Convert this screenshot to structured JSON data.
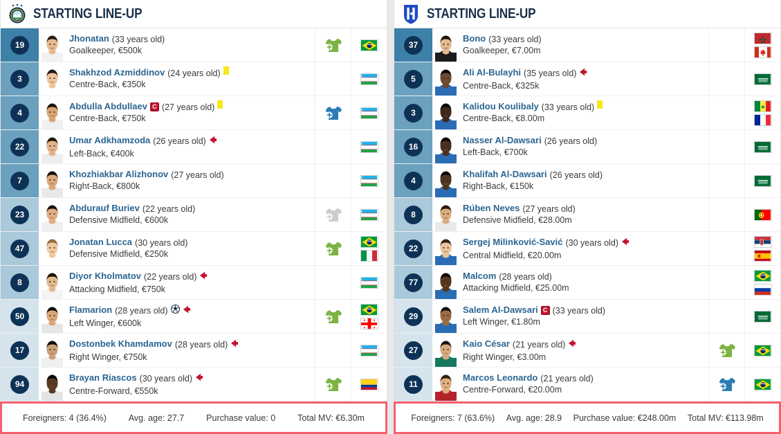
{
  "title": "Starting line-up comparison",
  "colors": {
    "accent_link": "#2b6591",
    "badge_bg": "#0e3255",
    "highlight_border": "#f4606e",
    "gk_tint": "#3d80a8",
    "def_tint": "#6ba0bf",
    "mid_tint": "#aac9da",
    "fwd_tint": "#d4e3ec"
  },
  "home": {
    "header": {
      "title": "STARTING LINE-UP",
      "logo_icon": "pakhtakor-club-logo"
    },
    "players": [
      {
        "number": "19",
        "name": "Jhonatan",
        "age": "(33 years old)",
        "position_value": "Goalkeeper, €500k",
        "tint": "t-gk",
        "captain": false,
        "yellow_card": false,
        "goal": false,
        "subbed_off": false,
        "sub_icon": "substitution-in-icon",
        "sub_icon_color": "#7cb342",
        "flags": [
          "brazil"
        ],
        "skin": "#e8b98f",
        "hair": "#2b1b10",
        "shirt": "#f2f2f2"
      },
      {
        "number": "3",
        "name": "Shakhzod Azmiddinov",
        "age": "(24 years old)",
        "position_value": "Centre-Back, €350k",
        "tint": "t-def",
        "captain": false,
        "yellow_card": true,
        "goal": false,
        "subbed_off": false,
        "sub_icon": "",
        "sub_icon_color": "",
        "flags": [
          "uzbekistan"
        ],
        "skin": "#edc49c",
        "hair": "#261810",
        "shirt": "#ffffff"
      },
      {
        "number": "4",
        "name": "Abdulla Abdullaev",
        "age": "(27 years old)",
        "position_value": "Centre-Back, €750k",
        "tint": "t-def",
        "captain": true,
        "yellow_card": true,
        "goal": false,
        "subbed_off": false,
        "sub_icon": "substitution-in-icon",
        "sub_icon_color": "#2b7cb5",
        "flags": [
          "uzbekistan"
        ],
        "skin": "#d9a475",
        "hair": "#1c120a",
        "shirt": "#f0f0f0"
      },
      {
        "number": "22",
        "name": "Umar Adkhamzoda",
        "age": "(26 years old)",
        "position_value": "Left-Back, €400k",
        "tint": "t-def",
        "captain": false,
        "yellow_card": false,
        "goal": false,
        "subbed_off": true,
        "sub_icon": "",
        "sub_icon_color": "",
        "flags": [
          "uzbekistan"
        ],
        "skin": "#e2b289",
        "hair": "#241609",
        "shirt": "#ededed"
      },
      {
        "number": "7",
        "name": "Khozhiakbar Alizhonov",
        "age": "(27 years old)",
        "position_value": "Right-Back, €800k",
        "tint": "t-def",
        "captain": false,
        "yellow_card": false,
        "goal": false,
        "subbed_off": false,
        "sub_icon": "",
        "sub_icon_color": "",
        "flags": [
          "uzbekistan"
        ],
        "skin": "#dba87c",
        "hair": "#140d07",
        "shirt": "#e8e8e8"
      },
      {
        "number": "23",
        "name": "Abdurauf Buriev",
        "age": "(22 years old)",
        "position_value": "Defensive Midfield, €600k",
        "tint": "t-mid",
        "captain": false,
        "yellow_card": false,
        "goal": false,
        "subbed_off": false,
        "sub_icon": "substitution-in-icon",
        "sub_icon_color": "#c9cdd0",
        "flags": [
          "uzbekistan"
        ],
        "skin": "#dfae83",
        "hair": "#1a110a",
        "shirt": "#efefef"
      },
      {
        "number": "47",
        "name": "Jonatan Lucca",
        "age": "(30 years old)",
        "position_value": "Defensive Midfield, €250k",
        "tint": "t-mid",
        "captain": false,
        "yellow_card": false,
        "goal": false,
        "subbed_off": false,
        "sub_icon": "substitution-in-icon",
        "sub_icon_color": "#7cb342",
        "flags": [
          "brazil",
          "italy"
        ],
        "skin": "#f0c9a2",
        "hair": "#9a6b3a",
        "shirt": "#ffffff"
      },
      {
        "number": "8",
        "name": "Diyor Kholmatov",
        "age": "(22 years old)",
        "position_value": "Attacking Midfield, €750k",
        "tint": "t-mid",
        "captain": false,
        "yellow_card": false,
        "goal": false,
        "subbed_off": true,
        "sub_icon": "",
        "sub_icon_color": "",
        "flags": [
          "uzbekistan"
        ],
        "skin": "#e4b98f",
        "hair": "#1d1209",
        "shirt": "#f4f4f4"
      },
      {
        "number": "50",
        "name": "Flamarion",
        "age": "(28 years old)",
        "position_value": "Left Winger, €600k",
        "tint": "t-fwd",
        "captain": false,
        "yellow_card": false,
        "goal": true,
        "subbed_off": true,
        "sub_icon": "substitution-in-icon",
        "sub_icon_color": "#7cb342",
        "flags": [
          "brazil",
          "georgia"
        ],
        "skin": "#d9a677",
        "hair": "#120b06",
        "shirt": "#e6e6e6"
      },
      {
        "number": "17",
        "name": "Dostonbek Khamdamov",
        "age": "(28 years old)",
        "position_value": "Right Winger, €750k",
        "tint": "t-fwd",
        "captain": false,
        "yellow_card": false,
        "goal": false,
        "subbed_off": true,
        "sub_icon": "",
        "sub_icon_color": "",
        "flags": [
          "uzbekistan"
        ],
        "skin": "#caa077",
        "hair": "#120b05",
        "shirt": "#efefef"
      },
      {
        "number": "94",
        "name": "Brayan Riascos",
        "age": "(30 years old)",
        "position_value": "Centre-Forward, €550k",
        "tint": "t-fwd",
        "captain": false,
        "yellow_card": false,
        "goal": false,
        "subbed_off": true,
        "sub_icon": "substitution-in-icon",
        "sub_icon_color": "#7cb342",
        "flags": [
          "colombia"
        ],
        "skin": "#5b3a23",
        "hair": "#0c0704",
        "shirt": "#e4e4e4"
      }
    ],
    "footer": {
      "foreigners": "Foreigners: 4 (36.4%)",
      "avg_age": "Avg. age: 27.7",
      "purchase_value": "Purchase value: 0",
      "total_mv": "Total MV: €6.30m"
    }
  },
  "away": {
    "header": {
      "title": "STARTING LINE-UP",
      "logo_icon": "al-hilal-club-logo"
    },
    "players": [
      {
        "number": "37",
        "name": "Bono",
        "age": "(33 years old)",
        "position_value": "Goalkeeper, €7.00m",
        "tint": "t-gk",
        "captain": false,
        "yellow_card": false,
        "goal": false,
        "subbed_off": false,
        "sub_icon": "",
        "sub_icon_color": "",
        "flags": [
          "morocco",
          "canada"
        ],
        "skin": "#e4b98f",
        "hair": "#1a110a",
        "shirt": "#1c1c1c"
      },
      {
        "number": "5",
        "name": "Ali Al-Bulayhi",
        "age": "(35 years old)",
        "position_value": "Centre-Back, €325k",
        "tint": "t-def",
        "captain": false,
        "yellow_card": false,
        "goal": false,
        "subbed_off": true,
        "sub_icon": "",
        "sub_icon_color": "",
        "flags": [
          "saudi-arabia"
        ],
        "skin": "#6b4a2f",
        "hair": "#0d0805",
        "shirt": "#2a6db5"
      },
      {
        "number": "3",
        "name": "Kalidou Koulibaly",
        "age": "(33 years old)",
        "position_value": "Centre-Back, €8.00m",
        "tint": "t-def",
        "captain": false,
        "yellow_card": true,
        "goal": false,
        "subbed_off": false,
        "sub_icon": "",
        "sub_icon_color": "",
        "flags": [
          "senegal",
          "france"
        ],
        "skin": "#3d2718",
        "hair": "#080504",
        "shirt": "#2a6db5"
      },
      {
        "number": "16",
        "name": "Nasser Al-Dawsari",
        "age": "(26 years old)",
        "position_value": "Left-Back, €700k",
        "tint": "t-def",
        "captain": false,
        "yellow_card": false,
        "goal": false,
        "subbed_off": false,
        "sub_icon": "",
        "sub_icon_color": "",
        "flags": [
          "saudi-arabia"
        ],
        "skin": "#4a3020",
        "hair": "#0a0604",
        "shirt": "#2a6db5"
      },
      {
        "number": "4",
        "name": "Khalifah Al-Dawsari",
        "age": "(26 years old)",
        "position_value": "Right-Back, €150k",
        "tint": "t-def",
        "captain": false,
        "yellow_card": false,
        "goal": false,
        "subbed_off": false,
        "sub_icon": "",
        "sub_icon_color": "",
        "flags": [
          "saudi-arabia"
        ],
        "skin": "#4d3422",
        "hair": "#0b0705",
        "shirt": "#2a6db5"
      },
      {
        "number": "8",
        "name": "Rúben Neves",
        "age": "(27 years old)",
        "position_value": "Defensive Midfield, €28.00m",
        "tint": "t-mid",
        "captain": false,
        "yellow_card": false,
        "goal": false,
        "subbed_off": false,
        "sub_icon": "",
        "sub_icon_color": "",
        "flags": [
          "portugal"
        ],
        "skin": "#dcab7e",
        "hair": "#2a1a0e",
        "shirt": "#e9e9e9"
      },
      {
        "number": "22",
        "name": "Sergej Milinković-Savić",
        "age": "(30 years old)",
        "position_value": "Central Midfield, €20.00m",
        "tint": "t-mid",
        "captain": false,
        "yellow_card": false,
        "goal": false,
        "subbed_off": true,
        "sub_icon": "",
        "sub_icon_color": "",
        "flags": [
          "serbia",
          "spain"
        ],
        "skin": "#ecc49b",
        "hair": "#3a2414",
        "shirt": "#2a6db5"
      },
      {
        "number": "77",
        "name": "Malcom",
        "age": "(28 years old)",
        "position_value": "Attacking Midfield, €25.00m",
        "tint": "t-mid",
        "captain": false,
        "yellow_card": false,
        "goal": false,
        "subbed_off": false,
        "sub_icon": "",
        "sub_icon_color": "",
        "flags": [
          "brazil",
          "russia"
        ],
        "skin": "#58371f",
        "hair": "#0b0604",
        "shirt": "#2a6db5"
      },
      {
        "number": "29",
        "name": "Salem Al-Dawsari",
        "age": "(33 years old)",
        "position_value": "Left Winger, €1.80m",
        "tint": "t-fwd",
        "captain": true,
        "yellow_card": false,
        "goal": false,
        "subbed_off": false,
        "sub_icon": "",
        "sub_icon_color": "",
        "flags": [
          "saudi-arabia"
        ],
        "skin": "#9c6b45",
        "hair": "#110a06",
        "shirt": "#2a6db5"
      },
      {
        "number": "27",
        "name": "Kaio César",
        "age": "(21 years old)",
        "position_value": "Right Winger, €3.00m",
        "tint": "t-fwd",
        "captain": false,
        "yellow_card": false,
        "goal": false,
        "subbed_off": true,
        "sub_icon": "substitution-in-icon",
        "sub_icon_color": "#7cb342",
        "flags": [
          "brazil"
        ],
        "skin": "#d6a97e",
        "hair": "#1b110a",
        "shirt": "#16795e"
      },
      {
        "number": "11",
        "name": "Marcos Leonardo",
        "age": "(21 years old)",
        "position_value": "Centre-Forward, €20.00m",
        "tint": "t-fwd",
        "captain": false,
        "yellow_card": false,
        "goal": false,
        "subbed_off": false,
        "sub_icon": "substitution-in-icon",
        "sub_icon_color": "#2b7cb5",
        "flags": [
          "brazil"
        ],
        "skin": "#dfae83",
        "hair": "#33200f",
        "shirt": "#b4232c"
      }
    ],
    "footer": {
      "foreigners": "Foreigners: 7 (63.6%)",
      "avg_age": "Avg. age: 28.9",
      "purchase_value": "Purchase value: €248.00m",
      "total_mv": "Total MV: €113.98m"
    }
  }
}
